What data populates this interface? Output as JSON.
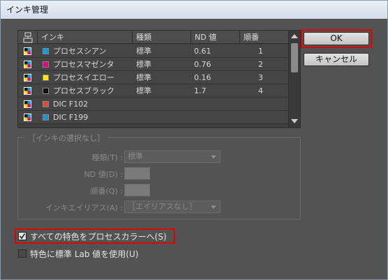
{
  "window": {
    "title": "インキ管理"
  },
  "table": {
    "columns": [
      "インキ",
      "種類",
      "ND 値",
      "順番"
    ],
    "rows": [
      {
        "name": "プロセスシアン",
        "type": "標準",
        "nd": "0.61",
        "order": "1",
        "swatch": "#00a0e6"
      },
      {
        "name": "プロセスマゼンタ",
        "type": "標準",
        "nd": "0.76",
        "order": "2",
        "swatch": "#e6007e"
      },
      {
        "name": "プロセスイエロー",
        "type": "標準",
        "nd": "0.16",
        "order": "3",
        "swatch": "#ffe600"
      },
      {
        "name": "プロセスブラック",
        "type": "標準",
        "nd": "1.7",
        "order": "4",
        "swatch": "#111111"
      },
      {
        "name": "DIC F102",
        "type": "",
        "nd": "",
        "order": "",
        "swatch": "#e04a3a"
      },
      {
        "name": "DIC F199",
        "type": "",
        "nd": "",
        "order": "",
        "swatch": "#1e90d6"
      }
    ]
  },
  "group": {
    "title": "［インキの選択なし］",
    "type_label": "種類(T) :",
    "type_value": "標準",
    "nd_label": "ND 値(D) :",
    "order_label": "順番(Q) :",
    "alias_label": "インキエイリアス(A) :",
    "alias_value": "［エイリアスなし］"
  },
  "buttons": {
    "ok": "OK",
    "cancel": "キャンセル"
  },
  "options": {
    "all_spots_to_process": "すべての特色をプロセスカラーへ(S)",
    "all_spots_checked": true,
    "use_lab": "特色に標準 Lab 値を使用(U)",
    "use_lab_checked": false
  },
  "colors": {
    "highlight": "#e00000",
    "background": "#535353"
  }
}
